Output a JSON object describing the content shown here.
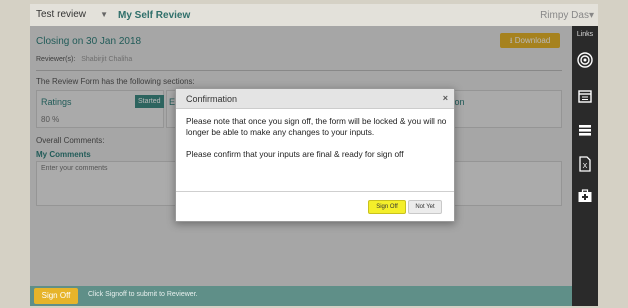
{
  "header": {
    "review_select": "Test review",
    "page_title": "My Self Review",
    "user_name": "Rimpy Das"
  },
  "main": {
    "closing": "Closing on 30 Jan 2018",
    "download_label": "Download",
    "reviewer_label": "Reviewer(s):",
    "reviewer_name": "Shabirjit Chaliha",
    "sections_note": "The Review Form has the following sections:",
    "ratings_label": "Ratings",
    "ratings_status": "Started",
    "ratings_percent": "80 %",
    "section2_partial": "E",
    "section3_partial": "otion",
    "overall_comments": "Overall Comments:",
    "my_comments": "My Comments",
    "comments_placeholder": "Enter your comments"
  },
  "footer": {
    "signoff_label": "Sign Off",
    "hint": "Click Signoff to submit to Reviewer."
  },
  "sidebar": {
    "links_label": "Links"
  },
  "modal": {
    "title": "Confirmation",
    "close": "×",
    "message1": "Please note that once you sign off, the form will be locked & you will no longer be able to make any changes to your inputs.",
    "message2": "Please confirm that your inputs are final & ready for sign off",
    "signoff_button": "Sign Off",
    "notyet_button": "Not Yet"
  },
  "colors": {
    "accent_yellow": "#e6b42a",
    "teal": "#2f7f7b",
    "highlight": "#f4ef2a"
  }
}
